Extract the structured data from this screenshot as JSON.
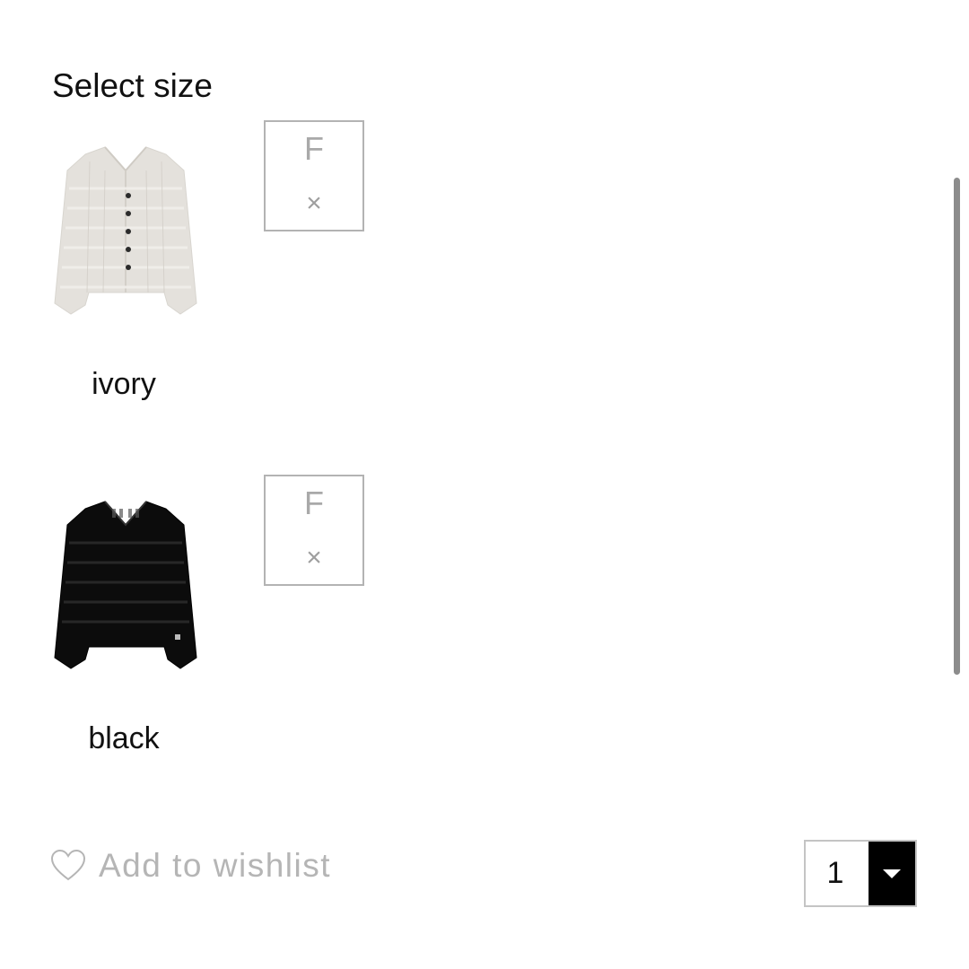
{
  "size_selector": {
    "title": "Select size"
  },
  "variants": [
    {
      "color": "ivory",
      "image_icon": "cardigan-ivory-image",
      "sizes": [
        {
          "label": "F",
          "status": "×",
          "available": false
        }
      ]
    },
    {
      "color": "black",
      "image_icon": "cardigan-black-image",
      "sizes": [
        {
          "label": "F",
          "status": "×",
          "available": false
        }
      ]
    }
  ],
  "wishlist": {
    "icon": "heart-icon",
    "label": "Add to wishlist"
  },
  "quantity": {
    "value": "1",
    "icon": "caret-down-icon"
  },
  "colors": {
    "text": "#111111",
    "muted": "#b5b5b5",
    "border": "#b3b3b3",
    "arrow_bg": "#000000",
    "scrollbar": "#8c8c8c"
  }
}
